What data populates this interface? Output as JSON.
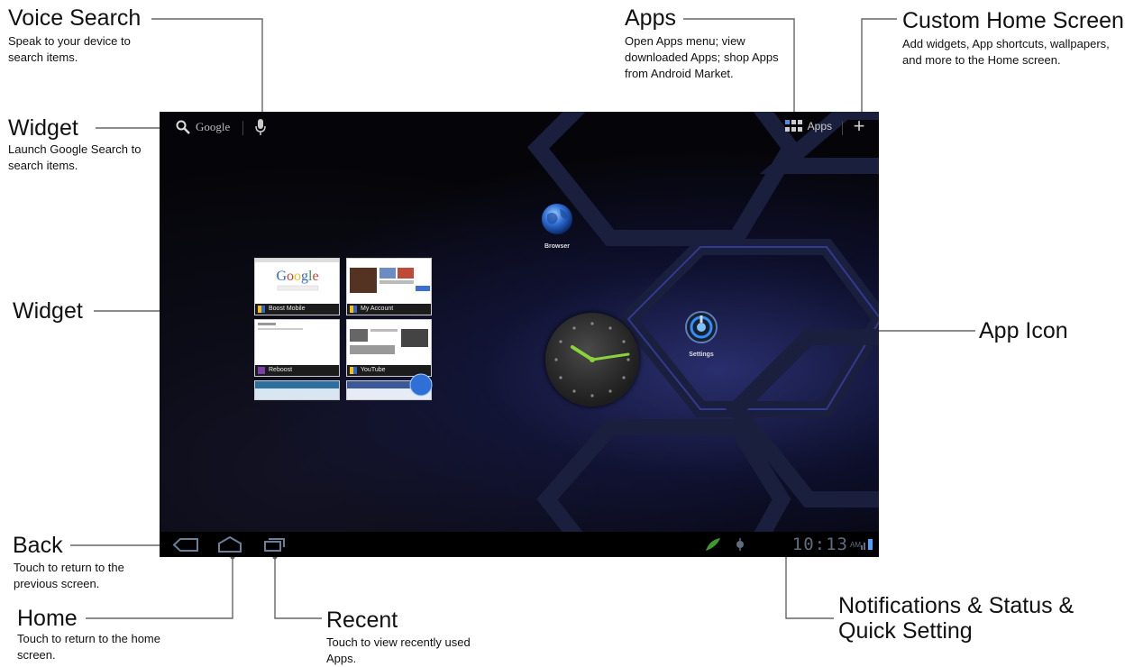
{
  "callouts": {
    "voice_search": {
      "title": "Voice Search",
      "desc": "Speak to your device to search items."
    },
    "widget_search": {
      "title": "Widget",
      "desc": "Launch Google Search to search items."
    },
    "widget": {
      "title": "Widget"
    },
    "back": {
      "title": "Back",
      "desc": "Touch to return to the previous screen."
    },
    "home": {
      "title": "Home",
      "desc": "Touch to return to the home screen."
    },
    "recent": {
      "title": "Recent",
      "desc": "Touch to view recently used Apps."
    },
    "apps": {
      "title": "Apps",
      "desc": "Open Apps menu; view downloaded Apps; shop Apps from Android Market."
    },
    "custom_home": {
      "title": "Custom Home Screen",
      "desc": "Add widgets, App shortcuts, wallpapers, and more to the Home screen."
    },
    "app_icon": {
      "title": "App Icon"
    },
    "notifications": {
      "title": "Notifications & Status & Quick Setting"
    }
  },
  "screen": {
    "search_label": "Google",
    "apps_label": "Apps",
    "browser_label": "Browser",
    "settings_label": "Settings",
    "bookmarks": [
      "Boost Mobile",
      "My Account",
      "Reboost",
      "YouTube"
    ],
    "time": "10:13",
    "ampm": "AM"
  },
  "colors": {
    "clock_hand": "#8bd33a",
    "accent_blue": "#2f6fd6"
  }
}
